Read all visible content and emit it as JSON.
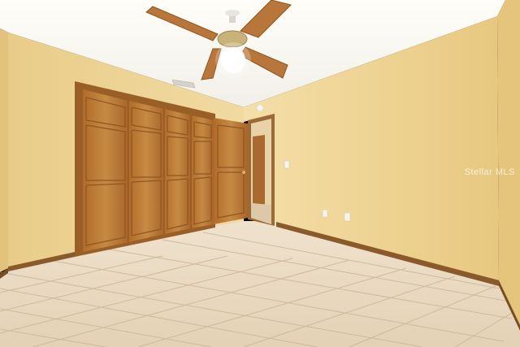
{
  "scene": {
    "description_label": "",
    "watermark_text": "Stellar MLS"
  },
  "colors": {
    "wall": "#f0d79a",
    "wall_right": "#ecd08f",
    "ceiling": "#f7f6f2",
    "floor": "#ead9c0",
    "door_wood": "#b9752f",
    "baseboard": "#8b5a2b"
  }
}
